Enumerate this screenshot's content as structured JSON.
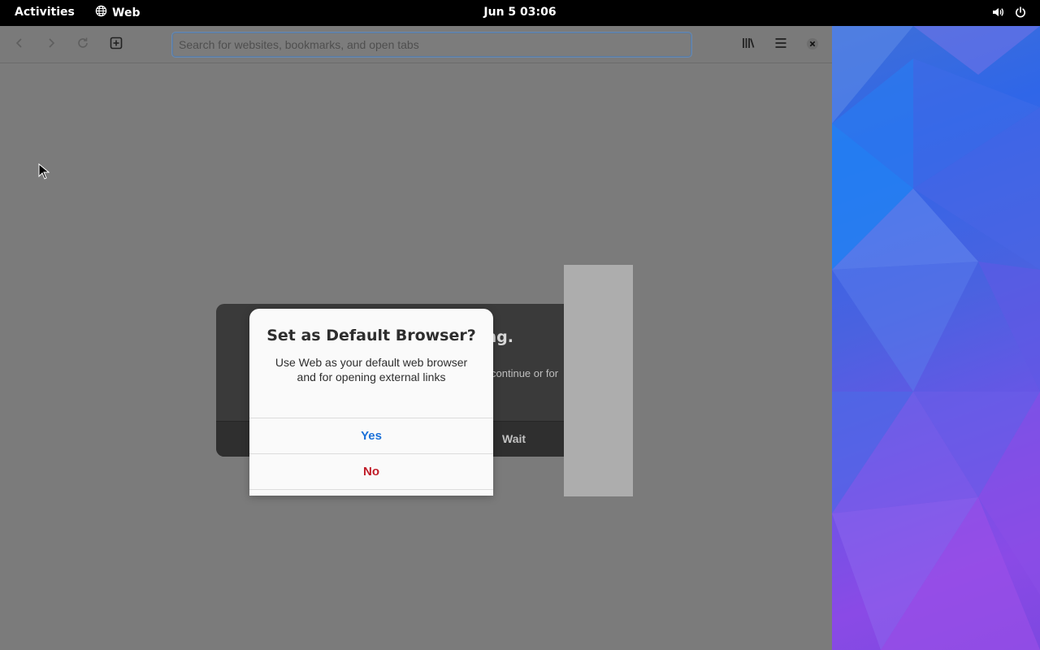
{
  "topbar": {
    "activities": "Activities",
    "app_name": "Web",
    "app_icon": "globe-icon",
    "clock": "Jun 5  03:06",
    "tray_icons": [
      "volume-icon",
      "power-icon"
    ]
  },
  "browser": {
    "toolbar": {
      "back_icon": "back-arrow-icon",
      "forward_icon": "forward-arrow-icon",
      "reload_icon": "reload-icon",
      "new_tab_icon": "new-tab-icon",
      "url_placeholder": "Search for websites, bookmarks, and open tabs",
      "url_value": "",
      "bookmarks_icon": "library-icon",
      "menu_icon": "hamburger-menu-icon",
      "close_icon": "close-icon"
    },
    "not_responding": {
      "title_fragment": "ng.",
      "body_fragment": "continue or for",
      "wait_label": "Wait"
    },
    "default_dialog": {
      "title": "Set as Default Browser?",
      "body": "Use Web as your default web browser and for opening external links",
      "yes_label": "Yes",
      "no_label": "No"
    }
  },
  "colors": {
    "yes_accent": "#1c71d8",
    "no_destructive": "#c01c28",
    "topbar_bg": "#000000"
  }
}
